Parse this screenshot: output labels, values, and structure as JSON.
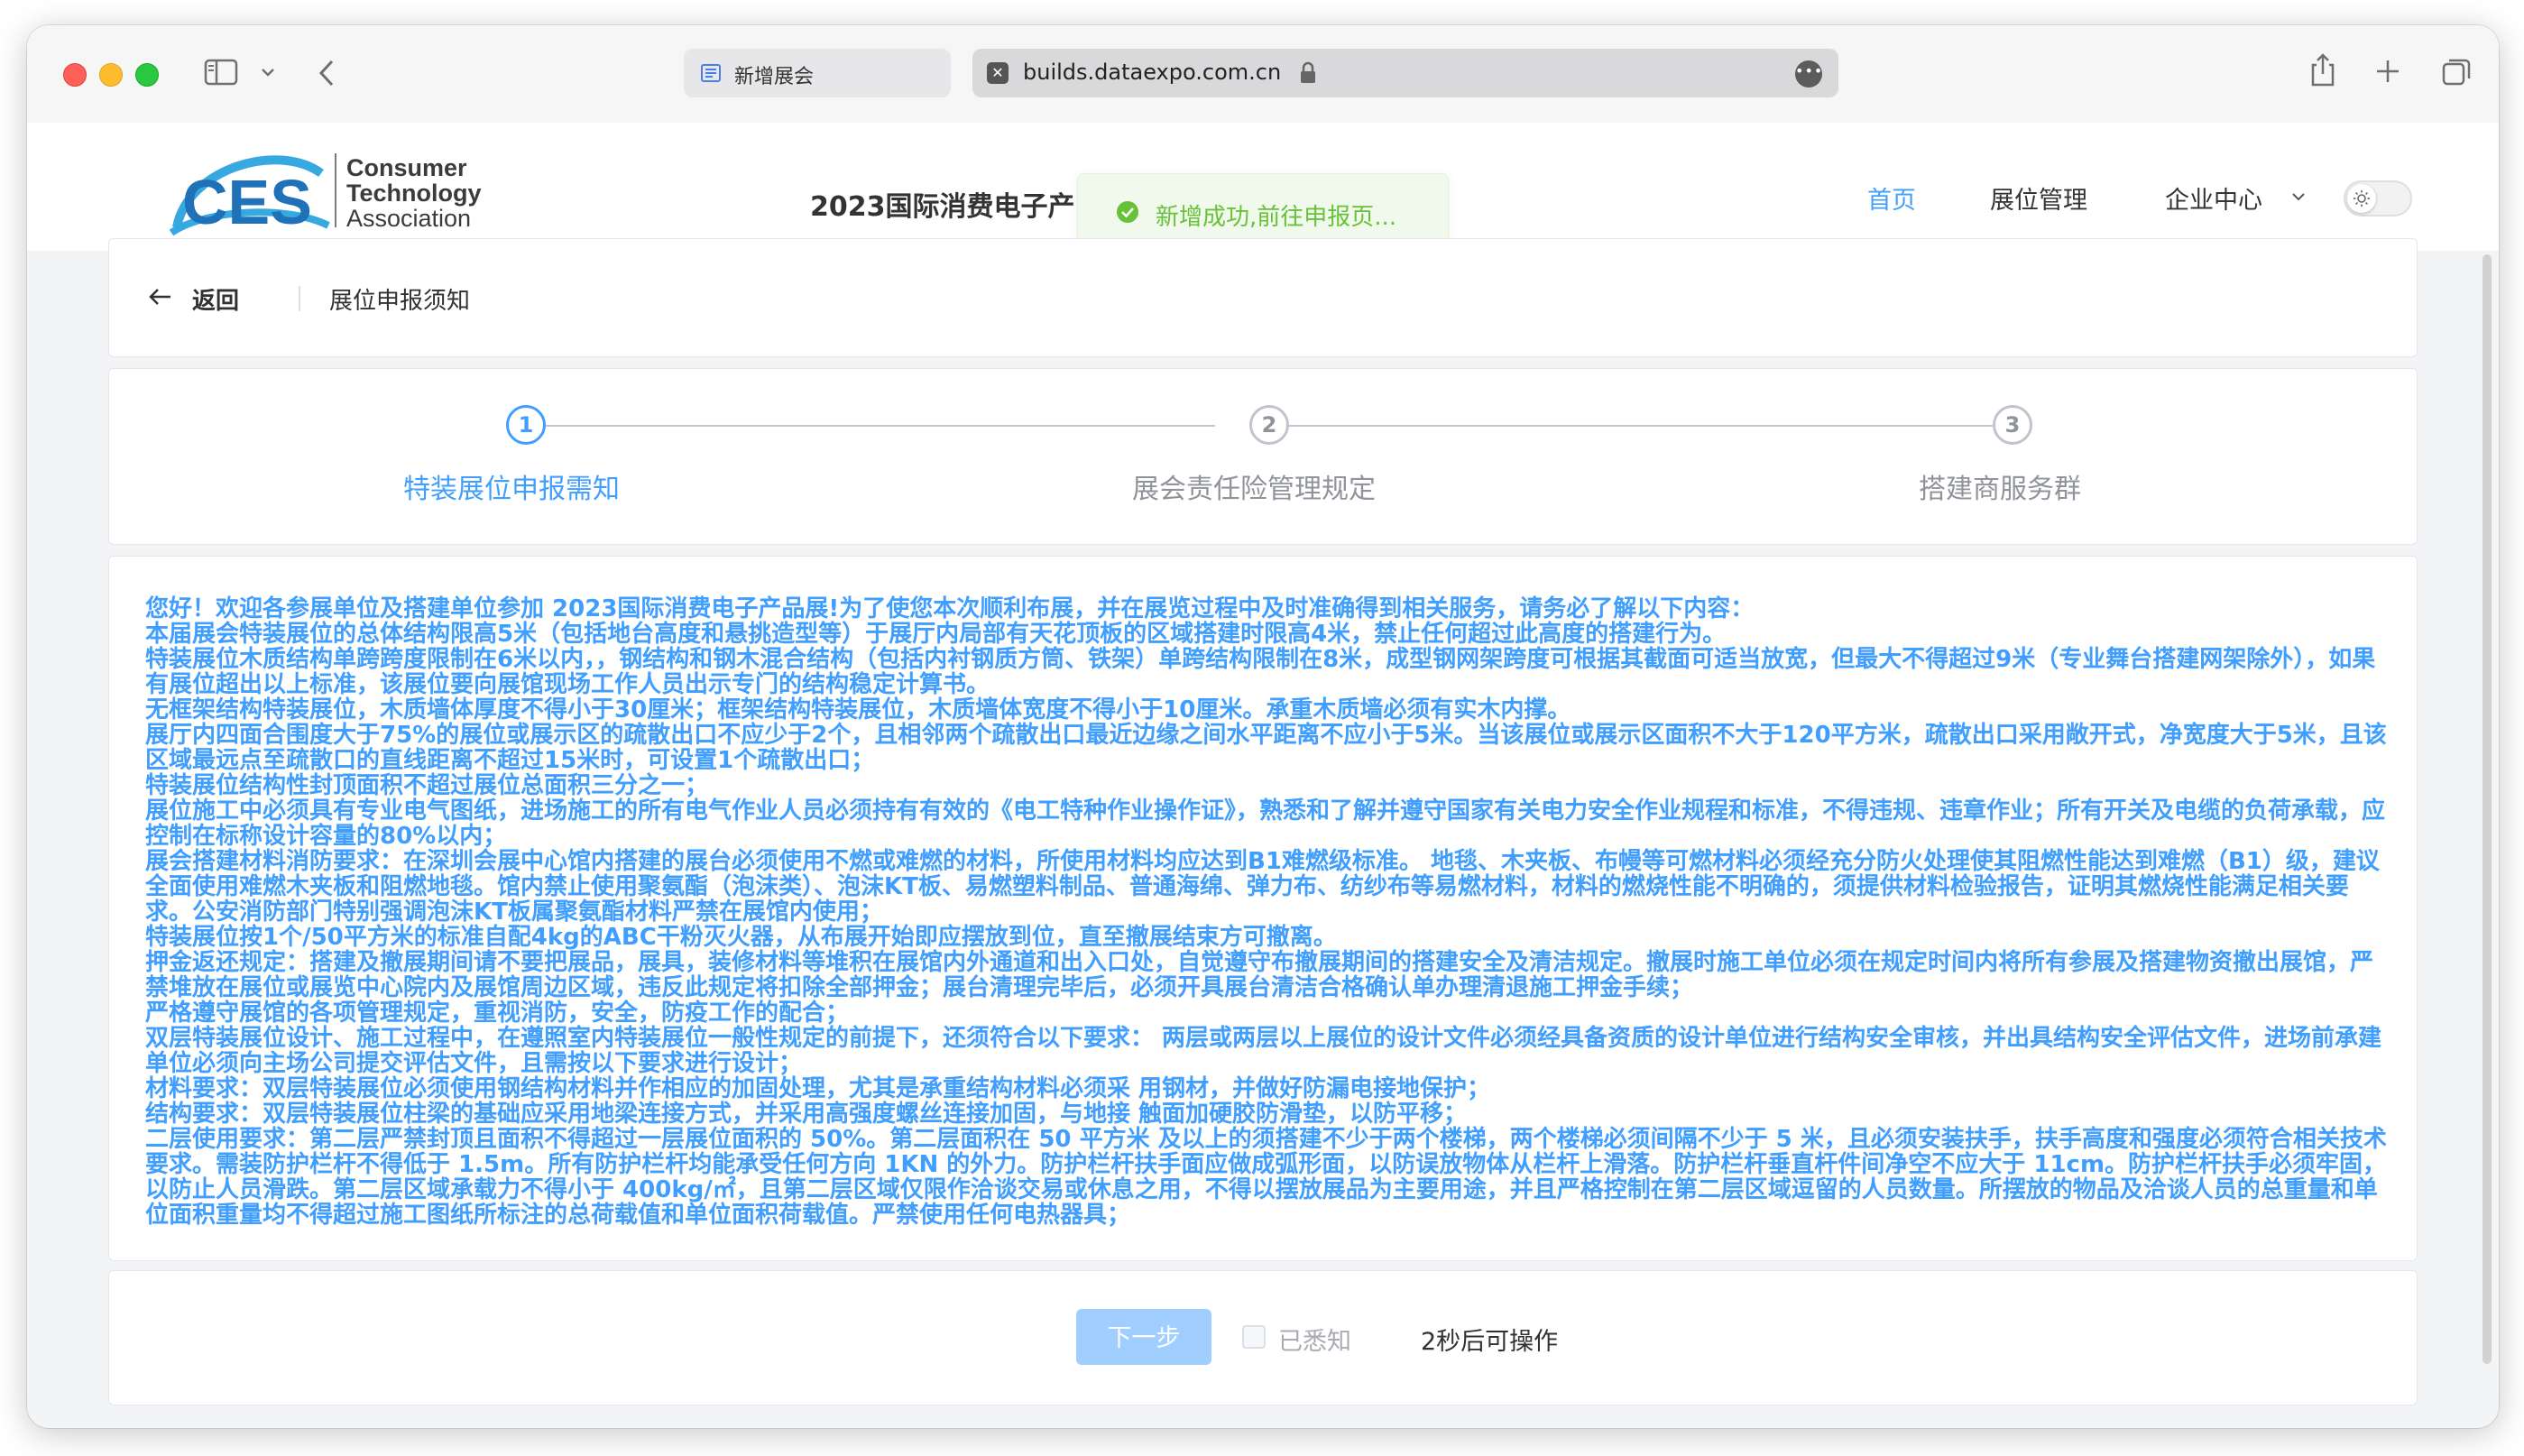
{
  "browser": {
    "tab_inactive_title": "新增展会",
    "url": "builds.dataexpo.com.cn"
  },
  "site": {
    "logo_ces": "CES",
    "logo_org_line1": "Consumer",
    "logo_org_line2": "Technology",
    "logo_org_line3": "Association",
    "event_title": "2023国际消费电子产",
    "toast_message": "新增成功,前往申报页...",
    "nav": {
      "home": "首页",
      "booth_management": "展位管理",
      "enterprise_center": "企业中心"
    }
  },
  "page": {
    "back_label": "返回",
    "heading": "展位申报须知"
  },
  "steps": [
    {
      "number": "1",
      "title": "特装展位申报需知",
      "active": true
    },
    {
      "number": "2",
      "title": "展会责任险管理规定",
      "active": false
    },
    {
      "number": "3",
      "title": "搭建商服务群",
      "active": false
    }
  ],
  "notice_lines": [
    "您好！欢迎各参展单位及搭建单位参加 2023国际消费电子产品展!为了使您本次顺利布展，并在展览过程中及时准确得到相关服务，请务必了解以下内容：",
    "本届展会特装展位的总体结构限高5米（包括地台高度和悬挑造型等）于展厅内局部有天花顶板的区域搭建时限高4米，禁止任何超过此高度的搭建行为。",
    "特装展位木质结构单跨跨度限制在6米以内，，钢结构和钢木混合结构（包括内衬钢质方筒、铁架）单跨结构限制在8米，成型钢网架跨度可根据其截面可适当放宽，但最大不得超过9米（专业舞台搭建网架除外），如果有展位超出以上标准，该展位要向展馆现场工作人员出示专门的结构稳定计算书。",
    "无框架结构特装展位，木质墙体厚度不得小于30厘米；框架结构特装展位，木质墙体宽度不得小于10厘米。承重木质墙必须有实木内撑。",
    "展厅内四面合围度大于75%的展位或展示区的疏散出口不应少于2个，且相邻两个疏散出口最近边缘之间水平距离不应小于5米。当该展位或展示区面积不大于120平方米，疏散出口采用敞开式，净宽度大于5米，且该区域最远点至疏散口的直线距离不超过15米时，可设置1个疏散出口；",
    "特装展位结构性封顶面积不超过展位总面积三分之一；",
    "展位施工中必须具有专业电气图纸，进场施工的所有电气作业人员必须持有有效的《电工特种作业操作证》，熟悉和了解并遵守国家有关电力安全作业规程和标准，不得违规、违章作业；所有开关及电缆的负荷承载，应控制在标称设计容量的80%以内；",
    "展会搭建材料消防要求：在深圳会展中心馆内搭建的展台必须使用不燃或难燃的材料，所使用材料均应达到B1难燃级标准。 地毯、木夹板、布幔等可燃材料必须经充分防火处理使其阻燃性能达到难燃（B1）级，建议全面使用难燃木夹板和阻燃地毯。馆内禁止使用聚氨酯（泡沫类）、泡沫KT板、易燃塑料制品、普通海绵、弹力布、纺纱布等易燃材料，材料的燃烧性能不明确的，须提供材料检验报告，证明其燃烧性能满足相关要求。公安消防部门特别强调泡沫KT板属聚氨酯材料严禁在展馆内使用；",
    "特装展位按1个/50平方米的标准自配4kg的ABC干粉灭火器，从布展开始即应摆放到位，直至撤展结束方可撤离。",
    "押金返还规定：搭建及撤展期间请不要把展品，展具，装修材料等堆积在展馆内外通道和出入口处，自觉遵守布撤展期间的搭建安全及清洁规定。撤展时施工单位必须在规定时间内将所有参展及搭建物资撤出展馆，严禁堆放在展位或展览中心院内及展馆周边区域，违反此规定将扣除全部押金；展台清理完毕后，必须开具展台清洁合格确认单办理清退施工押金手续；",
    "严格遵守展馆的各项管理规定，重视消防，安全，防疫工作的配合；",
    "双层特装展位设计、施工过程中，在遵照室内特装展位一般性规定的前提下，还须符合以下要求： 两层或两层以上展位的设计文件必须经具备资质的设计单位进行结构安全审核，并出具结构安全评估文件，进场前承建单位必须向主场公司提交评估文件，且需按以下要求进行设计；",
    "材料要求：双层特装展位必须使用钢结构材料并作相应的加固处理，尤其是承重结构材料必须采 用钢材，并做好防漏电接地保护；",
    "结构要求：双层特装展位柱梁的基础应采用地梁连接方式，并采用高强度螺丝连接加固，与地接 触面加硬胶防滑垫，以防平移；",
    "二层使用要求：第二层严禁封顶且面积不得超过一层展位面积的 50%。第二层面积在 50 平方米 及以上的须搭建不少于两个楼梯，两个楼梯必须间隔不少于 5 米，且必须安装扶手，扶手高度和强度必须符合相关技术要求。需装防护栏杆不得低于 1.5m。所有防护栏杆均能承受任何方向 1KN 的外力。防护栏杆扶手面应做成弧形面，以防误放物体从栏杆上滑落。防护栏杆垂直杆件间净空不应大于 11cm。防护栏杆扶手必须牢固，以防止人员滑跌。第二层区域承载力不得小于 400kg/㎡，且第二层区域仅限作洽谈交易或休息之用，不得以摆放展品为主要用途，并且严格控制在第二层区域逗留的人员数量。所摆放的物品及洽谈人员的总重量和单位面积重量均不得超过施工图纸所标注的总荷载值和单位面积荷载值。严禁使用任何电热器具；"
  ],
  "actions": {
    "next_label": "下一步",
    "ack_label": "已悉知",
    "countdown": "2秒后可操作"
  },
  "colors": {
    "primary": "#409eff",
    "success": "#67c23a",
    "disabled_button": "#a0cfff"
  }
}
